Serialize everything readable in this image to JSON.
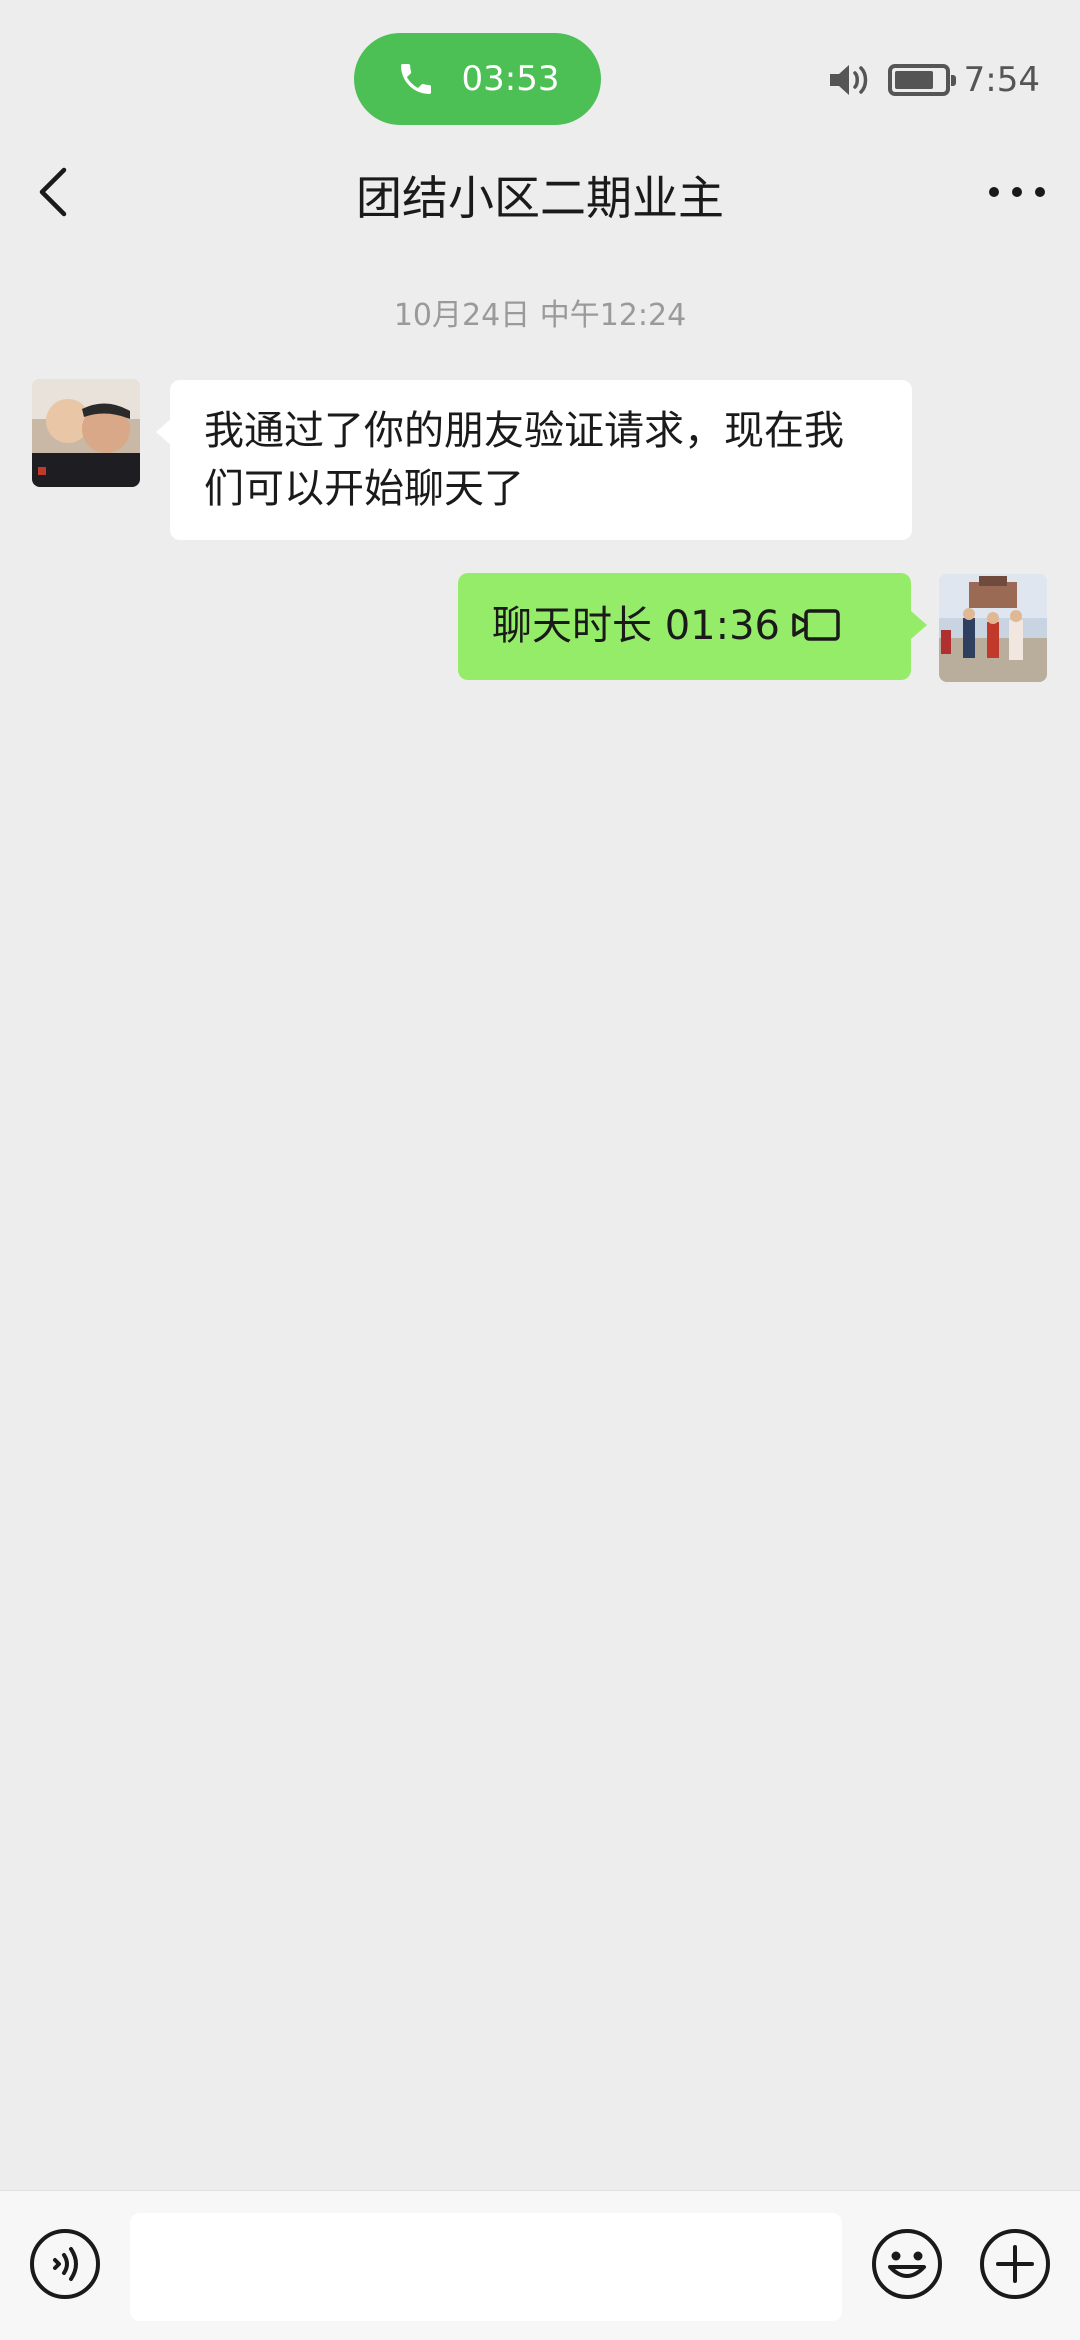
{
  "status_bar": {
    "call_timer": "03:53",
    "clock": "7:54",
    "battery_level": 0.8,
    "icons": [
      "phone-icon",
      "speaker-icon",
      "battery-icon"
    ]
  },
  "header": {
    "title": "团结小区二期业主",
    "icons": [
      "back-chevron-icon",
      "more-dots-icon"
    ]
  },
  "chat": {
    "timestamp": "10月24日 中午12:24",
    "messages": [
      {
        "direction": "incoming",
        "text": "我通过了你的朋友验证请求，现在我们可以开始聊天了"
      },
      {
        "direction": "outgoing",
        "text": "聊天时长 01:36",
        "icon": "video-call-icon"
      }
    ]
  },
  "input_bar": {
    "value": "",
    "placeholder": "",
    "icons": [
      "voice-icon",
      "emoji-icon",
      "plus-icon"
    ]
  },
  "colors": {
    "background": "#ededed",
    "call_pill": "#4cbf55",
    "outgoing_bubble": "#95ec69",
    "incoming_bubble": "#ffffff"
  }
}
